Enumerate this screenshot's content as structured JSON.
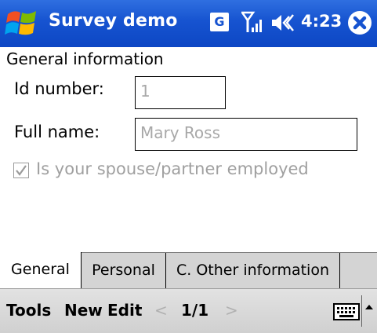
{
  "title_bar": {
    "app_title": "Survey demo",
    "network_letter": "G",
    "clock": "4:23"
  },
  "form": {
    "section_title": "General information",
    "id_label": "Id number:",
    "id_value": "1",
    "name_label": "Full name:",
    "name_value": "Mary Ross",
    "spouse_checkbox_label": "Is your spouse/partner employed",
    "spouse_checked": true
  },
  "tabs": [
    {
      "label": "General",
      "active": true
    },
    {
      "label": "Personal",
      "active": false
    },
    {
      "label": "C. Other information",
      "active": false
    }
  ],
  "menu_bar": {
    "tools": "Tools",
    "new": "New",
    "edit": "Edit",
    "prev_symbol": "<",
    "page_indicator": "1/1",
    "next_symbol": ">"
  },
  "colors": {
    "title_bar": "#1653d0",
    "disabled_text": "#a8a8a8",
    "menu_bar": "#d8d8d8"
  }
}
